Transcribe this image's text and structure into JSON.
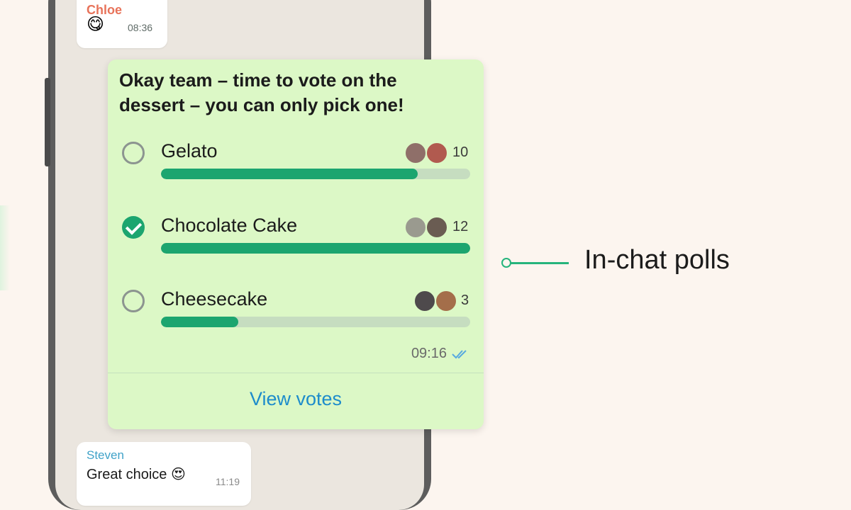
{
  "chat": {
    "messages": [
      {
        "sender": "Chloe",
        "emoji": "😋",
        "time": "08:36"
      },
      {
        "sender": "Steven",
        "text": "Great choice 😍",
        "time": "11:19"
      }
    ]
  },
  "poll": {
    "question": "Okay team – time to vote on the dessert – you can only pick one!",
    "options": [
      {
        "label": "Gelato",
        "votes": "10",
        "selected": false,
        "fill_fraction": 0.83,
        "avatar_colors": [
          "#8f6f69",
          "#b15a4f"
        ]
      },
      {
        "label": "Chocolate Cake",
        "votes": "12",
        "selected": true,
        "fill_fraction": 1.0,
        "avatar_colors": [
          "#9a9a8f",
          "#6a5c52"
        ]
      },
      {
        "label": "Cheesecake",
        "votes": "3",
        "selected": false,
        "fill_fraction": 0.25,
        "avatar_colors": [
          "#4e4a4c",
          "#a46e4a"
        ]
      }
    ],
    "time": "09:16",
    "status_icon": "double-check-icon",
    "view_votes_label": "View votes"
  },
  "callout": {
    "text": "In-chat polls"
  },
  "colors": {
    "background": "#fcf5ef",
    "bubble_green": "#dcf8c6",
    "accent_green": "#1ca56f",
    "link_blue": "#1d8ccb",
    "chloe_name": "#e8735a",
    "steven_name": "#3fa2c8"
  }
}
